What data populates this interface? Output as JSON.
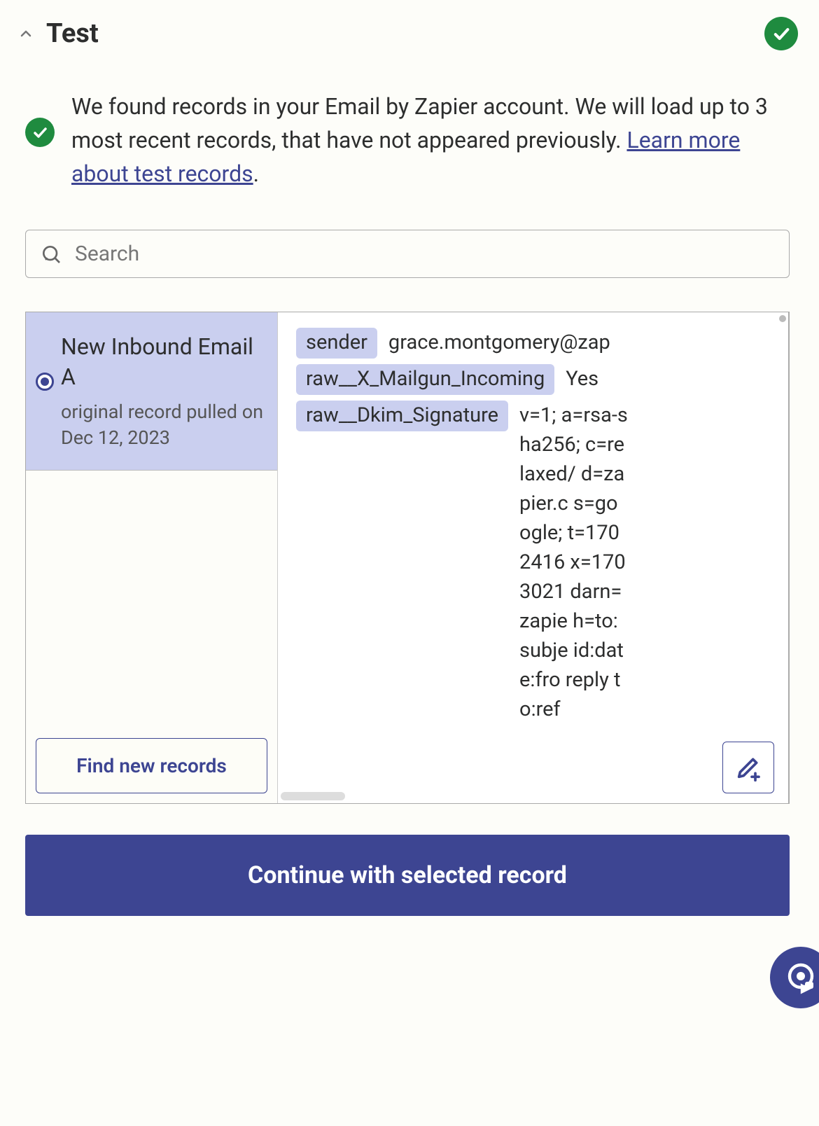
{
  "header": {
    "title": "Test"
  },
  "info": {
    "text_before_link": "We found records in your Email by Zapier account. We will load up to 3 most recent records, that have not appeared previously. ",
    "link_text": "Learn more about test records",
    "text_after_link": "."
  },
  "search": {
    "placeholder": "Search",
    "value": ""
  },
  "records": [
    {
      "title": "New Inbound Email A",
      "subtitle": "original record pulled on Dec 12, 2023",
      "selected": true
    }
  ],
  "find_button": "Find new records",
  "details": {
    "rows": [
      {
        "key": "sender",
        "value": "grace.montgomery@zap"
      },
      {
        "key": "raw__X_Mailgun_Incoming",
        "value": "Yes"
      },
      {
        "key": "raw__Dkim_Signature",
        "value": "v=1; a=rsa-sha256; c=relaxed/ d=zapier.c s=google; t=1702416 x=1703021 darn=zapie h=to:subje id:date:fro reply to:ref"
      }
    ]
  },
  "continue_button": "Continue with selected record"
}
